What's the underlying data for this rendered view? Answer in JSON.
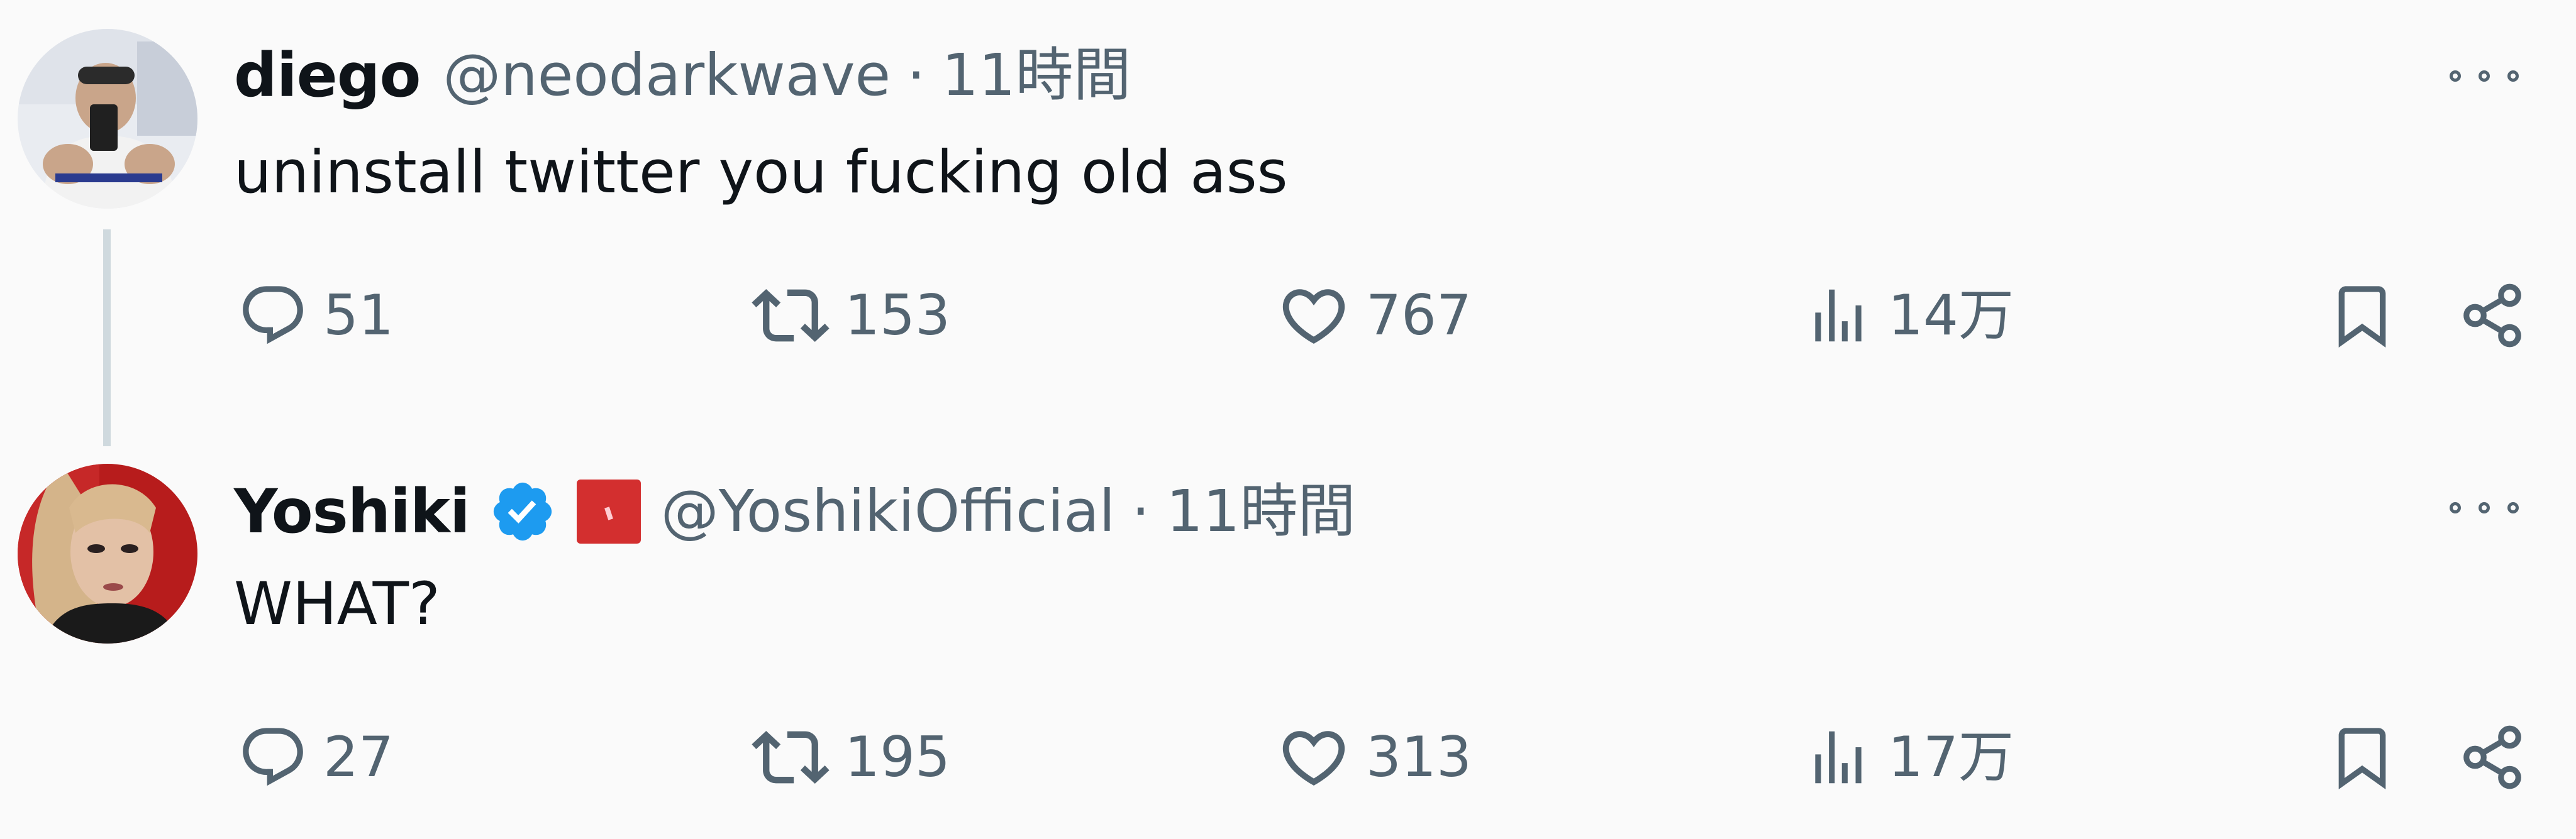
{
  "colors": {
    "background": "#fafafa",
    "text": "#0f1419",
    "secondary": "#536471",
    "thread_line": "#cfd9de",
    "verified": "#1d9bf0",
    "badge": "#d32f2f"
  },
  "tweets": [
    {
      "name": "diego",
      "handle": "@neodarkwave",
      "separator": "·",
      "time": "11時間",
      "text": "uninstall twitter you fucking old ass",
      "replies": "51",
      "retweets": "153",
      "likes": "767",
      "views": "14万",
      "verified": false
    },
    {
      "name": "Yoshiki",
      "handle": "@YoshikiOfficial",
      "separator": "·",
      "time": "11時間",
      "text": "WHAT?",
      "replies": "27",
      "retweets": "195",
      "likes": "313",
      "views": "17万",
      "verified": true
    }
  ],
  "icons": {
    "more": "more-dots-icon",
    "reply": "reply-bubble-icon",
    "retweet": "retweet-icon",
    "like": "heart-icon",
    "views": "views-bar-chart-icon",
    "bookmark": "bookmark-icon",
    "share": "share-icon",
    "verified": "verified-check-icon",
    "affiliate": "affiliate-badge-icon"
  }
}
